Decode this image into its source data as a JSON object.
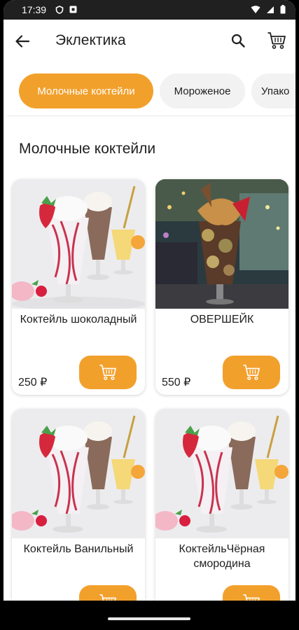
{
  "status": {
    "time": "17:39"
  },
  "app_bar": {
    "title": "Эклектика"
  },
  "categories": [
    {
      "label": "Молочные коктейли",
      "active": true
    },
    {
      "label": "Мороженое",
      "active": false
    },
    {
      "label": "Упако",
      "active": false
    }
  ],
  "section": {
    "title": "Молочные коктейли"
  },
  "products": [
    {
      "name": "Коктейль шоколадный",
      "price": "250 ₽"
    },
    {
      "name": "ОВЕРШЕЙК",
      "price": "550 ₽"
    },
    {
      "name": "Коктейль Ванильный",
      "price": ""
    },
    {
      "name": "КоктейльЧёрная смородина",
      "price": ""
    }
  ],
  "colors": {
    "accent": "#f2a02c",
    "chip_bg": "#f2f2f2",
    "text": "#1f1f1f"
  },
  "icons": [
    "back-arrow-icon",
    "search-icon",
    "cart-icon",
    "wifi-icon",
    "battery-icon"
  ]
}
